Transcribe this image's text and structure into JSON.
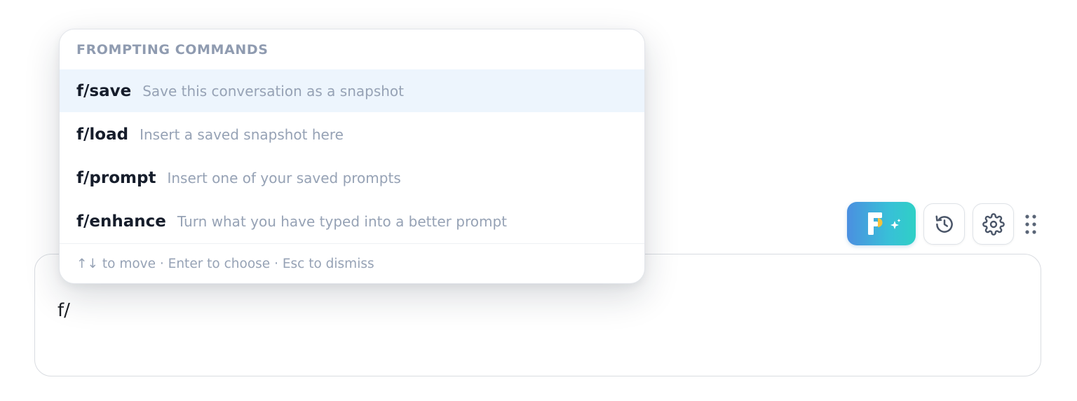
{
  "composer": {
    "text": "f/"
  },
  "toolbar": {
    "brand_icon": "frompt-logo-sparkle-icon",
    "history_icon": "history-icon",
    "settings_icon": "gear-icon",
    "drag_icon": "drag-handle-icon"
  },
  "popup": {
    "header": "FROMPTING COMMANDS",
    "commands": [
      {
        "name": "f/save",
        "description": "Save this conversation as a snapshot"
      },
      {
        "name": "f/load",
        "description": "Insert a saved snapshot here"
      },
      {
        "name": "f/prompt",
        "description": "Insert one of your saved prompts"
      },
      {
        "name": "f/enhance",
        "description": "Turn what you have typed into a better prompt"
      }
    ],
    "footer": "↑↓ to move · Enter to choose · Esc to dismiss"
  },
  "colors": {
    "accent_gradient_start": "#4b8fe0",
    "accent_gradient_end": "#2fd0c6",
    "active_row": "#edf5fd",
    "command_text": "#161d2b",
    "muted_text": "#96a2b5"
  }
}
